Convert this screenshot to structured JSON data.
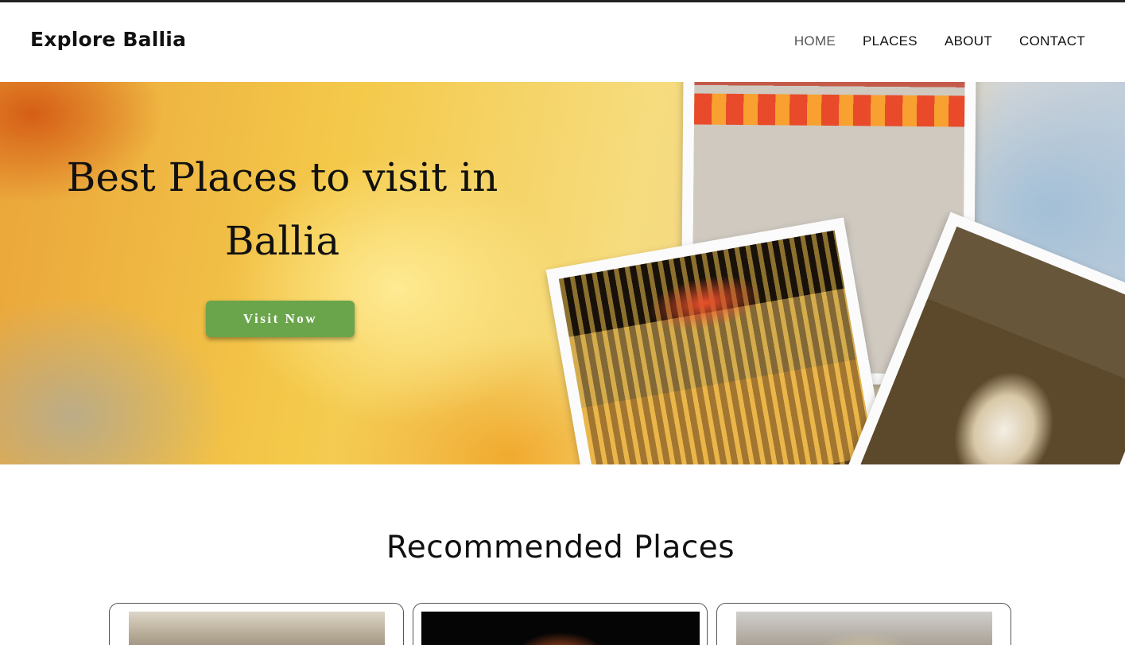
{
  "header": {
    "brand": "Explore Ballia",
    "nav": [
      {
        "label": "HOME",
        "active": true
      },
      {
        "label": "PLACES",
        "active": false
      },
      {
        "label": "ABOUT",
        "active": false
      },
      {
        "label": "CONTACT",
        "active": false
      }
    ]
  },
  "hero": {
    "title_line1": "Best Places to visit in",
    "title_line2": "Ballia",
    "button_label": "Visit Now",
    "button_color": "#6aa54b"
  },
  "recommended": {
    "title": "Recommended Places"
  }
}
